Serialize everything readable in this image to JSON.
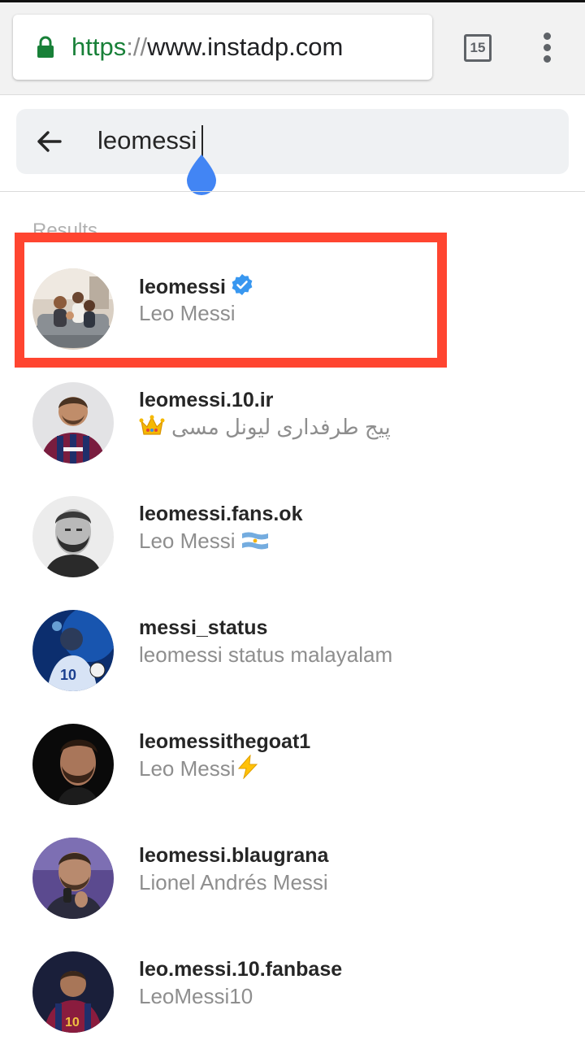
{
  "browser": {
    "url_scheme": "https",
    "url_separator": "://",
    "url_host": "www.instadp.com",
    "tab_count": "15",
    "accent_color": "#188038"
  },
  "search": {
    "query": "leomessi",
    "back_icon": "arrow-left-icon"
  },
  "results": {
    "label": "Results",
    "highlight_color": "#ff4530",
    "items": [
      {
        "username": "leomessi",
        "full_name": "Leo Messi",
        "verified": true
      },
      {
        "username": "leomessi.10.ir",
        "full_name": "پیج طرفداری لیونل مسی",
        "emoji": "crown"
      },
      {
        "username": "leomessi.fans.ok",
        "full_name": "Leo Messi",
        "emoji": "argentina-flag"
      },
      {
        "username": "messi_status",
        "full_name": "leomessi status malayalam"
      },
      {
        "username": "leomessithegoat1",
        "full_name": "Leo Messi",
        "emoji": "lightning"
      },
      {
        "username": "leomessi.blaugrana",
        "full_name": "Lionel Andrés Messi"
      },
      {
        "username": "leo.messi.10.fanbase",
        "full_name": "LeoMessi10"
      }
    ]
  }
}
